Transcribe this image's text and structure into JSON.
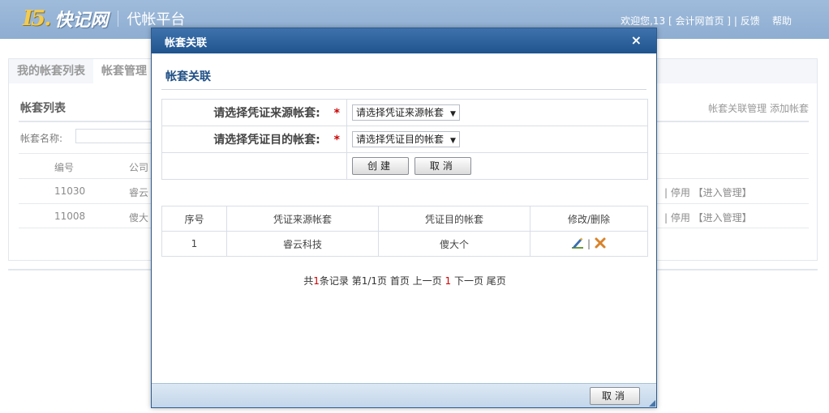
{
  "header": {
    "logo_mark": "I5.",
    "logo_text": "快记网",
    "platform": "代帐平台",
    "welcome": "欢迎您,13",
    "home_link": "[ 会计网首页 ]",
    "separator": "|",
    "feedback": "反馈",
    "help": "帮助"
  },
  "page": {
    "tabs": [
      "我的帐套列表",
      "帐套管理"
    ],
    "panel_title": "帐套列表",
    "actions": [
      "帐套关联管理",
      "添加帐套"
    ],
    "search_label": "帐套名称:",
    "columns": [
      "编号",
      "公司"
    ],
    "rows": [
      {
        "id": "11030",
        "company": "睿云",
        "ops": "| 停用 【进入管理】"
      },
      {
        "id": "11008",
        "company": "傻大",
        "ops": "| 停用 【进入管理】"
      }
    ]
  },
  "modal": {
    "title": "帐套关联",
    "close": "×",
    "section_title": "帐套关联",
    "source_label": "请选择凭证来源帐套:",
    "source_value": "请选择凭证来源帐套",
    "target_label": "请选择凭证目的帐套:",
    "target_value": "请选择凭证目的帐套",
    "required": "*",
    "create_button": "创建",
    "cancel_button": "取消",
    "table": {
      "headers": [
        "序号",
        "凭证来源帐套",
        "凭证目的帐套",
        "修改/删除"
      ],
      "rows": [
        {
          "index": "1",
          "source": "睿云科技",
          "target": "傻大个"
        }
      ]
    },
    "pager": {
      "prefix": "共",
      "count": "1",
      "mid": "条记录 第1/1页 首页 上一页",
      "current": "1",
      "suffix": "下一页 尾页"
    },
    "footer_cancel": "取消"
  },
  "colors": {
    "header_bg": "#7a9fc9",
    "modal_head": "#1f548f",
    "required": "#cc0000",
    "section_title": "#1f4f85"
  }
}
